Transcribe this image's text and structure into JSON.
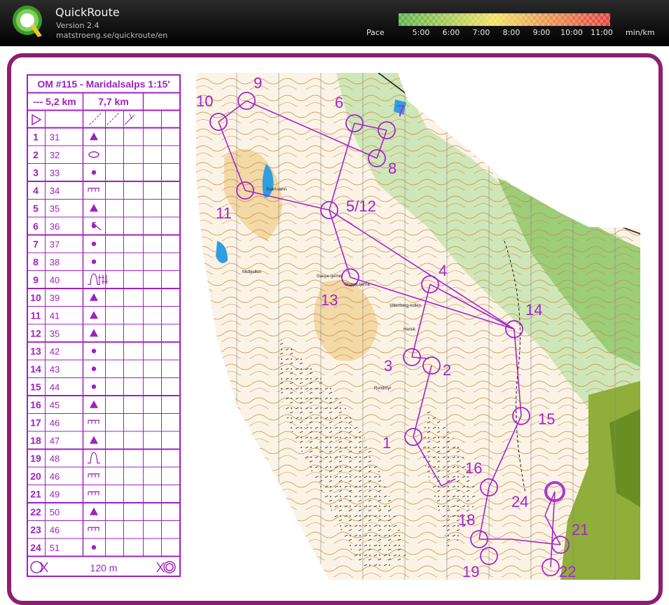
{
  "app": {
    "title": "QuickRoute",
    "version": "Version 2.4",
    "url": "matstroeng.se/quickroute/en"
  },
  "pace_legend": {
    "label": "Pace",
    "ticks": [
      "5:00",
      "6:00",
      "7:00",
      "8:00",
      "9:00",
      "10:00",
      "11:00"
    ],
    "unit": "min/km",
    "colors": [
      "#5ab14a",
      "#f0e060",
      "#e04040"
    ]
  },
  "description_sheet": {
    "title": "OM #115 - Maridalsalps 1:15'",
    "distance_a": "--- 5,2 km",
    "distance_b": "7,7 km",
    "rows": [
      {
        "num": "1",
        "code": "31",
        "symbol": "triangle"
      },
      {
        "num": "2",
        "code": "32",
        "symbol": "ellipse"
      },
      {
        "num": "3",
        "code": "33",
        "symbol": "dot"
      },
      {
        "num": "4",
        "code": "34",
        "symbol": "comb"
      },
      {
        "num": "5",
        "code": "35",
        "symbol": "triangle"
      },
      {
        "num": "6",
        "code": "36",
        "symbol": "dot",
        "extra": "arrow"
      },
      {
        "num": "7",
        "code": "37",
        "symbol": "dot"
      },
      {
        "num": "8",
        "code": "38",
        "symbol": "dot"
      },
      {
        "num": "9",
        "code": "40",
        "symbol": "knoll",
        "extra": "bars"
      },
      {
        "num": "10",
        "code": "39",
        "symbol": "triangle"
      },
      {
        "num": "11",
        "code": "41",
        "symbol": "triangle"
      },
      {
        "num": "12",
        "code": "35",
        "symbol": "triangle"
      },
      {
        "num": "13",
        "code": "42",
        "symbol": "dot"
      },
      {
        "num": "14",
        "code": "43",
        "symbol": "dot"
      },
      {
        "num": "15",
        "code": "44",
        "symbol": "dot"
      },
      {
        "num": "16",
        "code": "45",
        "symbol": "triangle"
      },
      {
        "num": "17",
        "code": "46",
        "symbol": "comb"
      },
      {
        "num": "18",
        "code": "47",
        "symbol": "triangle"
      },
      {
        "num": "19",
        "code": "48",
        "symbol": "knoll"
      },
      {
        "num": "20",
        "code": "46",
        "symbol": "comb"
      },
      {
        "num": "21",
        "code": "49",
        "symbol": "comb"
      },
      {
        "num": "22",
        "code": "50",
        "symbol": "triangle"
      },
      {
        "num": "23",
        "code": "46",
        "symbol": "comb"
      },
      {
        "num": "24",
        "code": "51",
        "symbol": "dot"
      }
    ],
    "finish_distance": "120 m"
  },
  "map": {
    "controls": [
      {
        "label": "1"
      },
      {
        "label": "2"
      },
      {
        "label": "3"
      },
      {
        "label": "4"
      },
      {
        "label": "5/12"
      },
      {
        "label": "6"
      },
      {
        "label": "7"
      },
      {
        "label": "8"
      },
      {
        "label": "9"
      },
      {
        "label": "10"
      },
      {
        "label": "11"
      },
      {
        "label": "13"
      },
      {
        "label": "14"
      },
      {
        "label": "15"
      },
      {
        "label": "16"
      },
      {
        "label": "18"
      },
      {
        "label": "19"
      },
      {
        "label": "21"
      },
      {
        "label": "22"
      },
      {
        "label": "24"
      }
    ],
    "place_names": [
      "Svart-vann",
      "Midtkollen",
      "Gaupe-tjernet",
      "Sluppe-tjerna",
      "Vittenberg-kollen",
      "Harisk",
      "Rundmyr"
    ]
  }
}
